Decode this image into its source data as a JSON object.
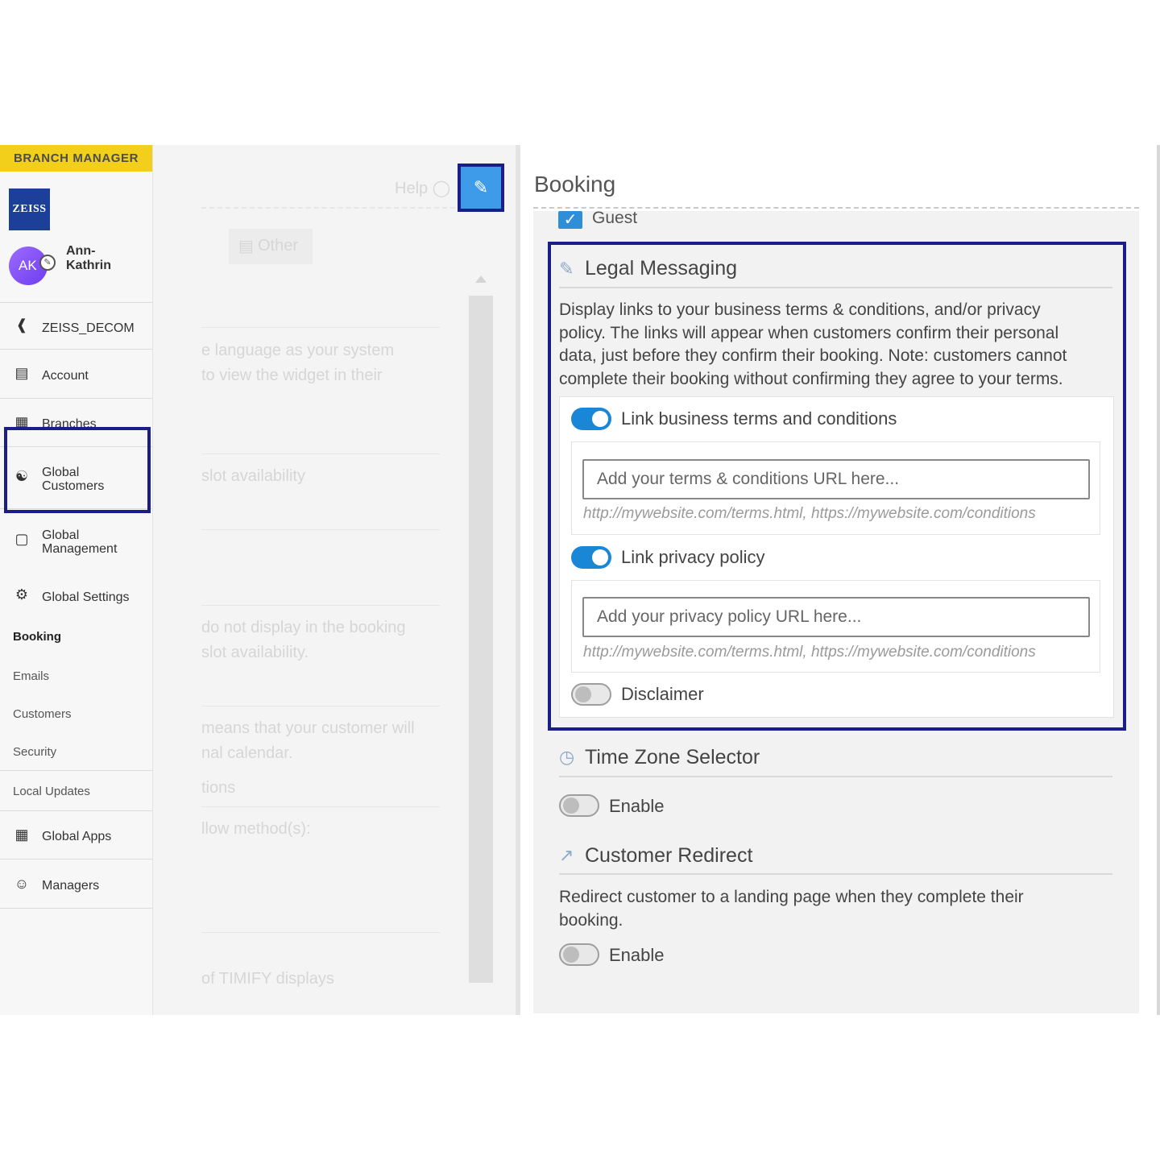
{
  "sidebar": {
    "role": "BRANCH MANAGER",
    "logo_text": "ZEISS",
    "user": {
      "initials": "AK",
      "name_line1": "Ann-",
      "name_line2": "Kathrin"
    },
    "back_item": "ZEISS_DECOM",
    "items": [
      {
        "label": "Account",
        "icon": "briefcase-icon"
      },
      {
        "label": "Branches",
        "icon": "building-icon"
      },
      {
        "label": "Global",
        "label2": "Customers",
        "icon": "users-icon"
      },
      {
        "label": "Global",
        "label2": "Management",
        "icon": "suitcase-icon"
      },
      {
        "label": "Global Settings",
        "icon": "gears-icon"
      },
      {
        "label": "Global Apps",
        "icon": "grid-icon"
      },
      {
        "label": "Managers",
        "icon": "user-icon"
      }
    ],
    "sub_items": [
      "Booking",
      "Emails",
      "Customers",
      "Security",
      "Local Updates"
    ]
  },
  "middle": {
    "help": "Help",
    "tab_other": "Other",
    "faded_texts": [
      "e language as your system",
      "to view the widget in their",
      "slot availability",
      "do not display in the booking",
      "slot availability.",
      "means that your customer will",
      "nal calendar.",
      "tions",
      "llow method(s):",
      "of TIMIFY displays"
    ]
  },
  "main": {
    "title": "Booking",
    "guest_label": "Guest",
    "legal": {
      "title": "Legal Messaging",
      "description_lines": [
        "Display links to your business terms & conditions, and/or privacy",
        "policy. The links will appear when customers confirm their personal",
        "data, just before they confirm their booking. Note: customers cannot",
        "complete their booking without confirming they agree to your terms."
      ],
      "terms_toggle_label": "Link business terms and conditions",
      "terms_toggle_on": true,
      "terms_placeholder": "Add your terms & conditions URL here...",
      "terms_hint": "http://mywebsite.com/terms.html, https://mywebsite.com/conditions",
      "privacy_toggle_label": "Link privacy policy",
      "privacy_toggle_on": true,
      "privacy_placeholder": "Add your privacy policy URL here...",
      "privacy_hint": "http://mywebsite.com/terms.html, https://mywebsite.com/conditions",
      "disclaimer_label": "Disclaimer",
      "disclaimer_on": false
    },
    "timezone": {
      "title": "Time Zone Selector",
      "enable_label": "Enable",
      "enabled": false
    },
    "redirect": {
      "title": "Customer Redirect",
      "description_lines": [
        "Redirect customer to a landing page when they complete their",
        "booking."
      ],
      "enable_label": "Enable",
      "enabled": false
    }
  },
  "colors": {
    "accent": "#1a86d6",
    "highlight_border": "#1a1d8a",
    "role_badge": "#f2cf1a",
    "avatar": "#8b55f7"
  }
}
